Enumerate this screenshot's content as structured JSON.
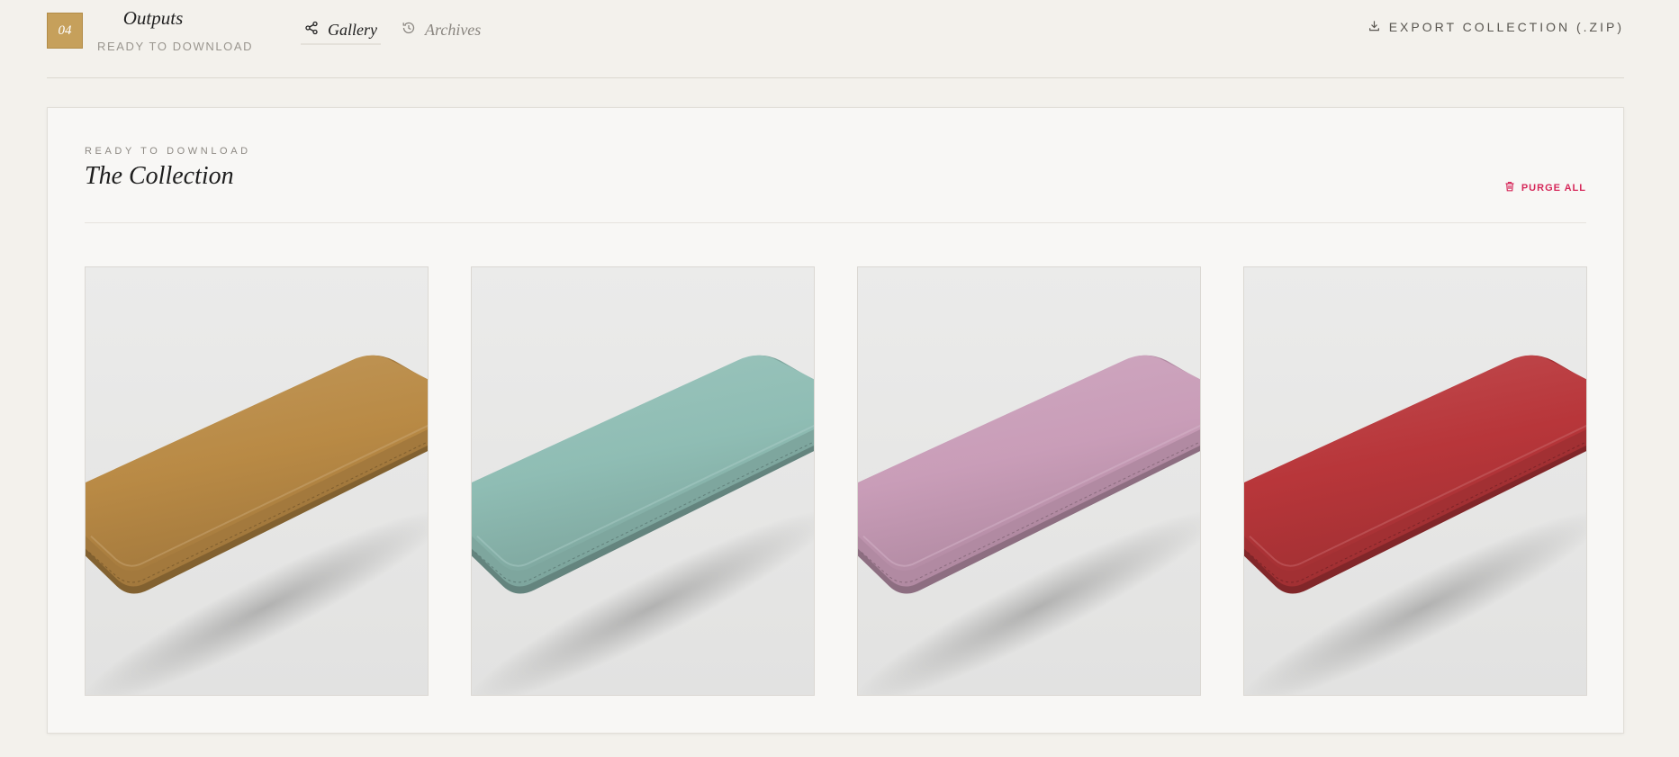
{
  "header": {
    "step_number": "04",
    "step_title": "Outputs",
    "step_subtitle": "READY TO DOWNLOAD",
    "tabs": [
      {
        "label": "Gallery",
        "icon": "share-icon",
        "active": true
      },
      {
        "label": "Archives",
        "icon": "history-icon",
        "active": false
      }
    ],
    "export_label": "EXPORT COLLECTION (.ZIP)",
    "accent_color": "#c6a05b"
  },
  "collection": {
    "eyebrow": "READY TO DOWNLOAD",
    "title": "The Collection",
    "purge_label": "PURGE ALL",
    "purge_color": "#d6285a",
    "items": [
      {
        "image": "leather wrist rest render",
        "color": "#b98a45"
      },
      {
        "image": "leather wrist rest render",
        "color": "#8fbdb4"
      },
      {
        "image": "leather wrist rest render",
        "color": "#c99db8"
      },
      {
        "image": "leather wrist rest render",
        "color": "#b8363a"
      }
    ]
  }
}
